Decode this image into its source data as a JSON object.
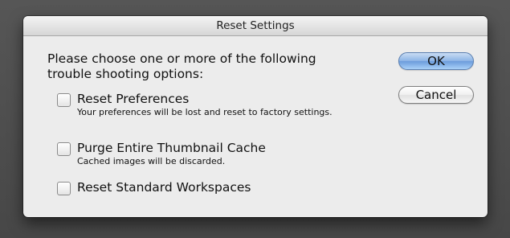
{
  "dialog": {
    "title": "Reset Settings",
    "prompt": "Please choose one or more of the following trouble shooting options:",
    "options": [
      {
        "label": "Reset Preferences",
        "description": "Your preferences will be lost and reset to factory settings.",
        "checked": false
      },
      {
        "label": "Purge Entire Thumbnail Cache",
        "description": "Cached images will be discarded.",
        "checked": false
      },
      {
        "label": "Reset Standard Workspaces",
        "description": "",
        "checked": false
      }
    ],
    "buttons": {
      "ok_label": "OK",
      "cancel_label": "Cancel"
    }
  }
}
